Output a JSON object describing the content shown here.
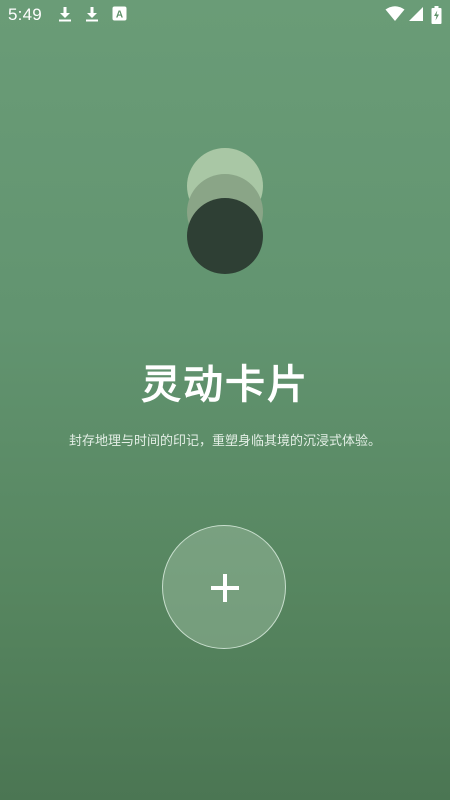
{
  "status_bar": {
    "time": "5:49",
    "notification_icons": [
      "download-icon",
      "download-icon",
      "font-app-icon"
    ],
    "system_icons": [
      "wifi-icon",
      "signal-icon",
      "battery-charging-icon"
    ],
    "notification_letter": "A"
  },
  "logo": {
    "icon": "stacked-circles-logo-icon",
    "colors": [
      "#a9c7a5",
      "#8aa587",
      "#2e3f34"
    ]
  },
  "main": {
    "title": "灵动卡片",
    "subtitle": "封存地理与时间的印记，重塑身临其境的沉浸式体验。"
  },
  "add_button": {
    "icon": "plus-icon"
  },
  "colors": {
    "background_top": "#6a9c77",
    "background_bottom": "#4b7653",
    "text": "#ffffff"
  }
}
